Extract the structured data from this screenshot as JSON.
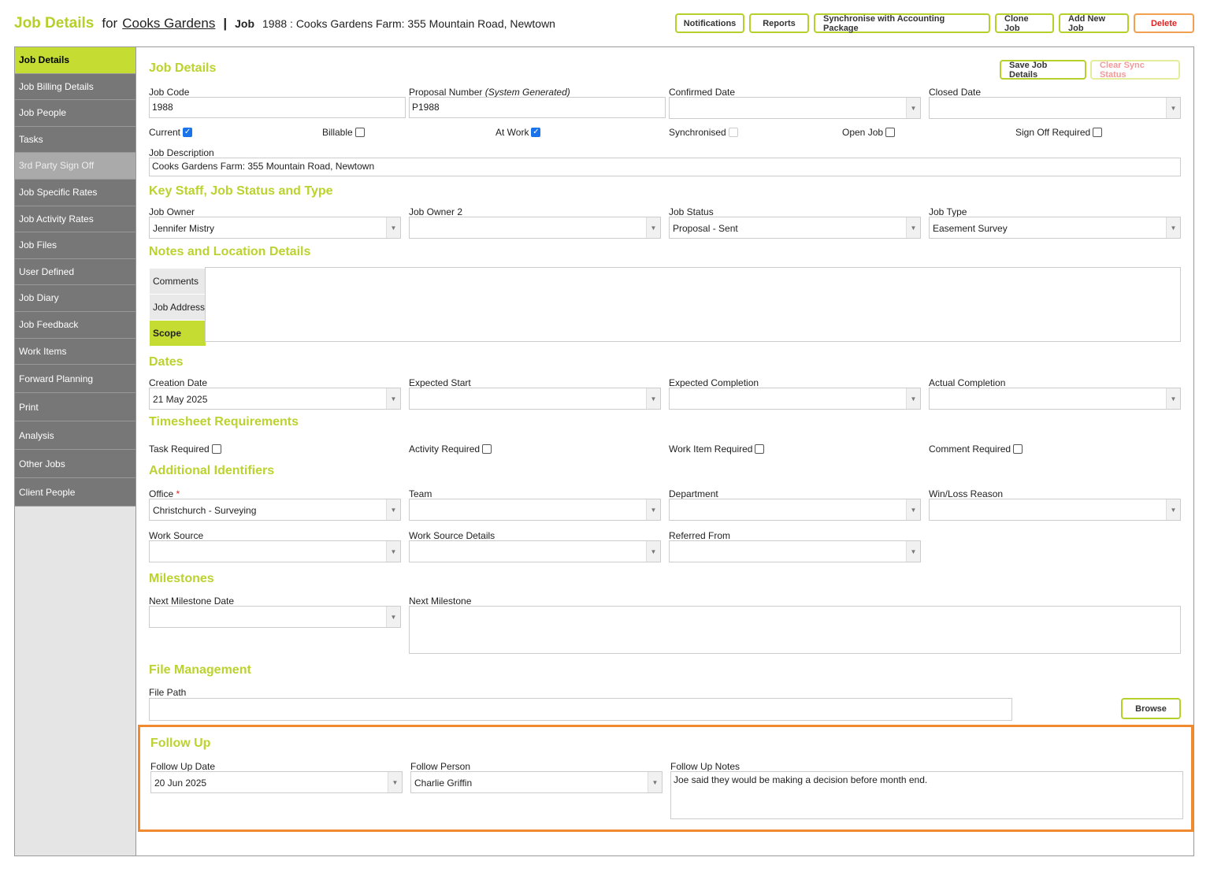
{
  "header": {
    "title": "Job Details",
    "for": "for",
    "client": "Cooks Gardens",
    "separator": "|",
    "job_label": "Job",
    "job_desc": "1988 : Cooks Gardens Farm: 355 Mountain Road, Newtown",
    "buttons": {
      "notifications": "Notifications",
      "reports": "Reports",
      "sync": "Synchronise with Accounting Package",
      "clone": "Clone Job",
      "add": "Add New Job",
      "delete": "Delete"
    }
  },
  "sidebar": {
    "items": [
      {
        "label": "Job Details"
      },
      {
        "label": "Job Billing Details"
      },
      {
        "label": "Job People"
      },
      {
        "label": "Tasks"
      },
      {
        "label": "3rd Party Sign Off"
      },
      {
        "label": "Job Specific Rates"
      },
      {
        "label": "Job Activity Rates"
      },
      {
        "label": "Job Files"
      },
      {
        "label": "User Defined"
      },
      {
        "label": "Job Diary"
      },
      {
        "label": "Job Feedback"
      },
      {
        "label": "Work Items"
      },
      {
        "label": "Forward Planning"
      },
      {
        "label": "Print"
      },
      {
        "label": "Analysis"
      },
      {
        "label": "Other Jobs"
      },
      {
        "label": "Client People"
      }
    ]
  },
  "details": {
    "section": "Job Details",
    "save": "Save Job Details",
    "clear_sync": "Clear Sync Status",
    "job_code_label": "Job Code",
    "job_code": "1988",
    "proposal_label": "Proposal Number",
    "proposal_note": "(System Generated)",
    "proposal": "P1988",
    "confirmed_label": "Confirmed Date",
    "closed_label": "Closed Date",
    "current": "Current",
    "billable": "Billable",
    "at_work": "At Work",
    "synchronised": "Synchronised",
    "open_job": "Open Job",
    "sign_off": "Sign Off Required",
    "desc_label": "Job Description",
    "desc": "Cooks Gardens Farm: 355 Mountain Road, Newtown"
  },
  "staff": {
    "section": "Key Staff, Job Status and Type",
    "owner_label": "Job Owner",
    "owner": "Jennifer Mistry",
    "owner2_label": "Job Owner 2",
    "status_label": "Job Status",
    "status": "Proposal - Sent",
    "type_label": "Job Type",
    "type": "Easement Survey"
  },
  "notes": {
    "section": "Notes and Location Details",
    "tabs": [
      "Comments",
      "Job Address",
      "Scope"
    ]
  },
  "dates": {
    "section": "Dates",
    "creation_label": "Creation Date",
    "creation": "21 May 2025",
    "exp_start_label": "Expected Start",
    "exp_comp_label": "Expected Completion",
    "actual_label": "Actual Completion"
  },
  "timesheet": {
    "section": "Timesheet Requirements",
    "task": "Task Required",
    "activity": "Activity Required",
    "work_item": "Work Item Required",
    "comment": "Comment Required"
  },
  "ids": {
    "section": "Additional Identifiers",
    "office_label": "Office",
    "req": "*",
    "office": "Christchurch - Surveying",
    "team_label": "Team",
    "dept_label": "Department",
    "winloss_label": "Win/Loss Reason",
    "source_label": "Work Source",
    "source_details_label": "Work Source Details",
    "referred_label": "Referred From"
  },
  "milestones": {
    "section": "Milestones",
    "date_label": "Next Milestone Date",
    "next_label": "Next Milestone"
  },
  "files": {
    "section": "File Management",
    "path_label": "File Path",
    "browse": "Browse"
  },
  "followup": {
    "section": "Follow Up",
    "date_label": "Follow Up Date",
    "date": "20 Jun 2025",
    "person_label": "Follow Person",
    "person": "Charlie Griffin",
    "notes_label": "Follow Up Notes",
    "notes": "Joe said they would be making a decision before month end."
  },
  "colors": {
    "accent": "#c5dc32",
    "highlight": "#f08a30",
    "delete": "#e02020"
  }
}
